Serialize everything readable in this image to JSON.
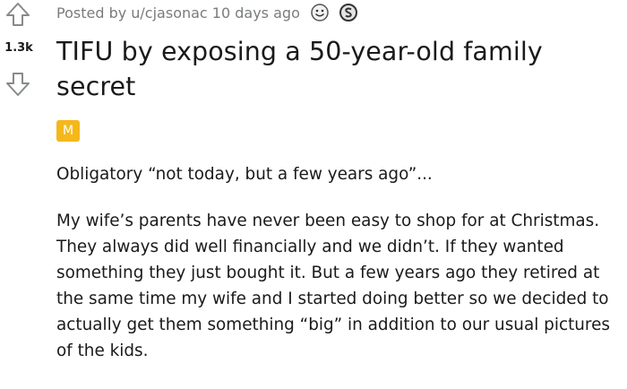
{
  "post": {
    "score": "1.3k",
    "meta": "Posted by u/cjasonac 10 days ago",
    "title": "TIFU by exposing a 50-year-old family secret",
    "flair": "M",
    "paragraphs": [
      "Obligatory “not today, but a few years ago”...",
      "My wife’s parents have never been easy to shop for at Christmas. They always did well financially and we didn’t. If they wanted something they just bought it. But a few years ago they retired at the same time my wife and I started doing better so we decided to actually get them something “big” in addition to our usual pictures of the kids."
    ],
    "awards": [
      "smiley-award-icon",
      "silver-award-icon"
    ],
    "colors": {
      "flair": "#f5b81b",
      "meta": "#787c7e",
      "text": "#1a1a1b"
    }
  }
}
